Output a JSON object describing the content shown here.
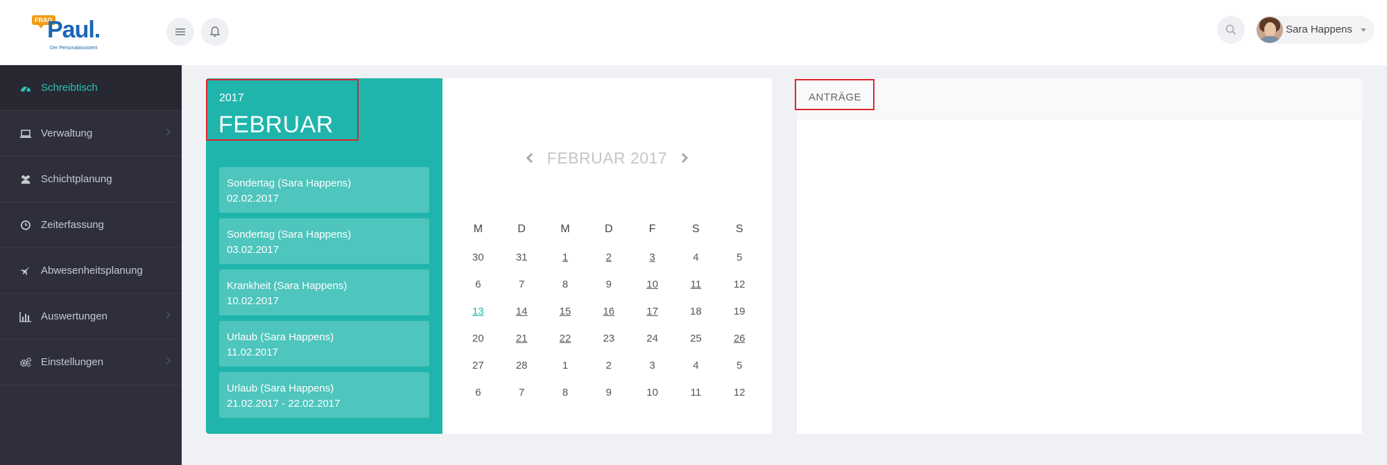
{
  "logo": {
    "badge": "FRAG",
    "name": "Paul.",
    "tagline": "Der Personalassistent"
  },
  "header": {
    "menu_icon": "hamburger-menu-icon",
    "notification_icon": "bell-icon",
    "search_icon": "search-icon",
    "user": {
      "name": "Sara Happens"
    }
  },
  "sidebar": {
    "items": [
      {
        "label": "Schreibtisch",
        "icon": "dashboard-icon",
        "active": true,
        "has_children": false
      },
      {
        "label": "Verwaltung",
        "icon": "laptop-icon",
        "active": false,
        "has_children": true
      },
      {
        "label": "Schichtplanung",
        "icon": "users-icon",
        "active": false,
        "has_children": false
      },
      {
        "label": "Zeiterfassung",
        "icon": "clock-icon",
        "active": false,
        "has_children": false
      },
      {
        "label": "Abwesenheitsplanung",
        "icon": "plane-icon",
        "active": false,
        "has_children": false
      },
      {
        "label": "Auswertungen",
        "icon": "bar-chart-icon",
        "active": false,
        "has_children": true
      },
      {
        "label": "Einstellungen",
        "icon": "gears-icon",
        "active": false,
        "has_children": true
      }
    ]
  },
  "calendar": {
    "year": "2017",
    "month": "FEBRUAR",
    "nav_title": "FEBRUAR 2017",
    "events": [
      {
        "title": "Sondertag (Sara Happens)",
        "date": "02.02.2017"
      },
      {
        "title": "Sondertag (Sara Happens)",
        "date": "03.02.2017"
      },
      {
        "title": "Krankheit (Sara Happens)",
        "date": "10.02.2017"
      },
      {
        "title": "Urlaub (Sara Happens)",
        "date": "11.02.2017"
      },
      {
        "title": "Urlaub (Sara Happens)",
        "date": "21.02.2017 - 22.02.2017"
      }
    ],
    "weekdays": [
      "M",
      "D",
      "M",
      "D",
      "F",
      "S",
      "S"
    ],
    "weeks": [
      [
        "30",
        "31",
        "1",
        "2",
        "3",
        "4",
        "5"
      ],
      [
        "6",
        "7",
        "8",
        "9",
        "10",
        "11",
        "12"
      ],
      [
        "13",
        "14",
        "15",
        "16",
        "17",
        "18",
        "19"
      ],
      [
        "20",
        "21",
        "22",
        "23",
        "24",
        "25",
        "26"
      ],
      [
        "27",
        "28",
        "1",
        "2",
        "3",
        "4",
        "5"
      ],
      [
        "6",
        "7",
        "8",
        "9",
        "10",
        "11",
        "12"
      ]
    ],
    "underlined_days": [
      "1",
      "2",
      "3",
      "10",
      "11",
      "14",
      "15",
      "16",
      "17",
      "21",
      "22",
      "26"
    ],
    "today": "13",
    "accent_color": "#1fb5ac"
  },
  "requests": {
    "title": "ANTRÄGE"
  },
  "colors": {
    "sidebar_bg": "#2e2f3a",
    "accent": "#1fb5ac",
    "highlight_box": "#e0242d"
  }
}
